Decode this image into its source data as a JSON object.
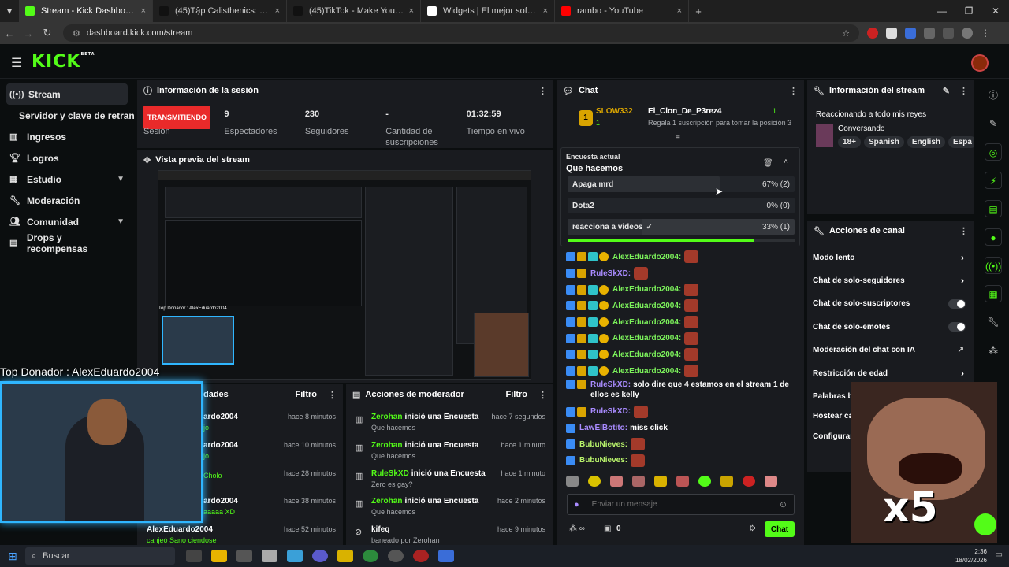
{
  "browser": {
    "tabs": [
      {
        "title": "Stream - Kick Dashboard",
        "color": "#53fc18",
        "active": true
      },
      {
        "title": "(45)Tập Calisthenics: Hướng Dẫ",
        "color": "#111111",
        "active": false
      },
      {
        "title": "(45)TikTok - Make Your Day",
        "color": "#111111",
        "active": false
      },
      {
        "title": "Widgets | El mejor software pa",
        "color": "#ffffff",
        "active": false
      },
      {
        "title": "rambo - YouTube",
        "color": "#ff0000",
        "active": false
      }
    ],
    "url": "dashboard.kick.com/stream"
  },
  "kick": {
    "logo": "KICK",
    "logo_sup": "BETA"
  },
  "sidebar": {
    "items": [
      {
        "label": "Stream",
        "icon": "stream-icon"
      },
      {
        "label": "Servidor y clave de retransm",
        "icon": ""
      },
      {
        "label": "Ingresos",
        "icon": "chart-icon"
      },
      {
        "label": "Logros",
        "icon": "trophy-icon"
      },
      {
        "label": "Estudio",
        "icon": "studio-icon"
      },
      {
        "label": "Moderación",
        "icon": "wrench-icon"
      },
      {
        "label": "Comunidad",
        "icon": "people-icon"
      },
      {
        "label": "Drops y recompensas",
        "icon": "gift-icon"
      }
    ]
  },
  "session": {
    "title": "Información de la sesión",
    "live_badge": "TRANSMITIENDO",
    "session_label": "Sesión",
    "stats": [
      {
        "value": "9",
        "label": "Espectadores"
      },
      {
        "value": "230",
        "label": "Seguidores"
      },
      {
        "value": "-",
        "label": "Cantidad de suscripciones"
      },
      {
        "value": "01:32:59",
        "label": "Tiempo en vivo"
      }
    ]
  },
  "preview": {
    "title": "Vista previa del stream",
    "top_donor_small": "Top Donador : AlexEduardo2004"
  },
  "activity": {
    "title_partial": "dades",
    "filter": "Filtro",
    "items": [
      {
        "name": "ardo2004",
        "sub": "jo",
        "time": "hace 8 minutos"
      },
      {
        "name": "ardo2004",
        "sub": "jo",
        "time": "hace 10 minutos"
      },
      {
        "name": "",
        "sub": "Cholo",
        "time": "hace 28 minutos"
      },
      {
        "name": "ardo2004",
        "sub": "aaaaa XD",
        "time": "hace 38 minutos"
      },
      {
        "name": "AlexEduardo2004",
        "sub": "canjeó Sano ciendose",
        "time": "hace 52 minutos"
      }
    ]
  },
  "modactions": {
    "title": "Acciones de moderador",
    "filter": "Filtro",
    "items": [
      {
        "user": "Zerohan",
        "action": "inició una Encuesta",
        "sub": "Que hacemos",
        "time": "hace 7 segundos"
      },
      {
        "user": "Zerohan",
        "action": "inició una Encuesta",
        "sub": "Que hacemos",
        "time": "hace 1 minuto"
      },
      {
        "user": "RuleSkXD",
        "action": "inició una Encuesta",
        "sub": "Zero es gay?",
        "time": "hace 1 minuto"
      },
      {
        "user": "Zerohan",
        "action": "inició una Encuesta",
        "sub": "Que hacemos",
        "time": "hace 2 minutos"
      },
      {
        "user": "kifeq",
        "action": "",
        "sub": "baneado por Zerohan",
        "time": "hace 9 minutos"
      }
    ]
  },
  "chat": {
    "title": "Chat",
    "pinned": {
      "rank": "1",
      "user1": "SLOW332",
      "user1_count": "1",
      "user2": "El_Clon_De_P3rez4",
      "user2_count": "1",
      "note": "Regala 1 suscripción para tomar la posición 3"
    },
    "poll": {
      "header": "Encuesta actual",
      "question": "Que hacemos",
      "options": [
        {
          "label": "Apaga mrd",
          "result": "67% (2)",
          "fraction": 0.67
        },
        {
          "label": "Dota2",
          "result": "0% (0)",
          "fraction": 0.0
        },
        {
          "label": "reacciona a videos",
          "result": "33% (1)",
          "fraction": 0.33
        }
      ],
      "timer_fraction": 0.82
    },
    "messages": [
      {
        "user": "AlexEduardo2004:",
        "text": "",
        "cls": "u-green2",
        "badges": 4,
        "emote": true
      },
      {
        "user": "RuleSkXD:",
        "text": "",
        "cls": "u-purple",
        "badges": 2,
        "emote": true
      },
      {
        "user": "AlexEduardo2004:",
        "text": "",
        "cls": "u-green2",
        "badges": 4,
        "emote": true
      },
      {
        "user": "AlexEduardo2004:",
        "text": "",
        "cls": "u-green2",
        "badges": 4,
        "emote": true
      },
      {
        "user": "AlexEduardo2004:",
        "text": "",
        "cls": "u-green2",
        "badges": 4,
        "emote": true
      },
      {
        "user": "AlexEduardo2004:",
        "text": "",
        "cls": "u-green2",
        "badges": 4,
        "emote": true
      },
      {
        "user": "AlexEduardo2004:",
        "text": "",
        "cls": "u-green2",
        "badges": 4,
        "emote": true
      },
      {
        "user": "AlexEduardo2004:",
        "text": "",
        "cls": "u-green2",
        "badges": 4,
        "emote": true
      },
      {
        "user": "RuleSkXD:",
        "text": "solo dire que 4 estamos en el stream 1 de ellos es kelly",
        "cls": "u-purple",
        "badges": 2,
        "emote": false
      },
      {
        "user": "RuleSkXD:",
        "text": "",
        "cls": "u-purple",
        "badges": 2,
        "emote": true
      },
      {
        "user": "LawElBotito:",
        "text": "miss click",
        "cls": "u-purple",
        "badges": 1,
        "emote": false
      },
      {
        "user": "BubuNieves:",
        "text": "",
        "cls": "u-lime",
        "badges": 1,
        "emote": true
      },
      {
        "user": "BubuNieves:",
        "text": "",
        "cls": "u-lime",
        "badges": 1,
        "emote": true
      }
    ],
    "input_placeholder": "Enviar un mensaje",
    "points": "0",
    "send_label": "Chat"
  },
  "stream_info": {
    "title": "Información del stream",
    "stream_title": "Reaccionando a todo mis reyes",
    "category": "Conversando",
    "tags": [
      "18+",
      "Spanish",
      "English",
      "Espa"
    ]
  },
  "channel_actions": {
    "title": "Acciones de canal",
    "items": [
      {
        "label": "Modo lento",
        "control": "chevron"
      },
      {
        "label": "Chat de solo-seguidores",
        "control": "chevron"
      },
      {
        "label": "Chat de solo-suscriptores",
        "control": "toggle"
      },
      {
        "label": "Chat de solo-emotes",
        "control": "toggle"
      },
      {
        "label": "Moderación del chat con IA",
        "control": "external"
      },
      {
        "label": "Restricción de edad",
        "control": "chevron"
      },
      {
        "label": "Palabras ba",
        "control": ""
      },
      {
        "label": "Hostear car",
        "control": ""
      },
      {
        "label": "Configurar c",
        "control": ""
      }
    ]
  },
  "overlay": {
    "top_donor": "Top Donador : AlexEduardo2004",
    "meme_text": "x5"
  },
  "taskbar": {
    "search": "Buscar",
    "time": "2:36",
    "date": "18/02/2026"
  },
  "colors": {
    "kick_green": "#53fc18",
    "live_red": "#e92a2a",
    "panel": "#191b1f"
  }
}
